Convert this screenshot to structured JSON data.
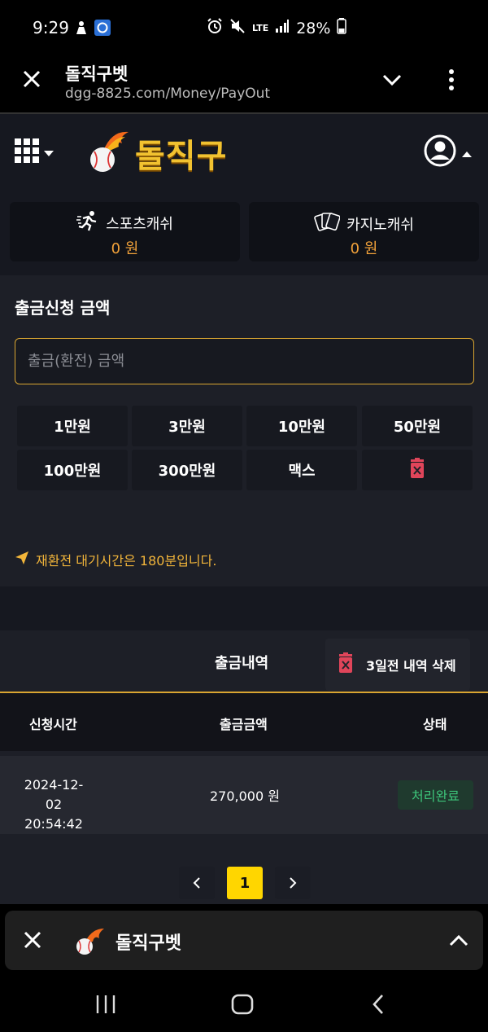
{
  "status_bar": {
    "time": "9:29",
    "battery": "28%",
    "network": "LTE"
  },
  "browser": {
    "title": "돌직구벳",
    "url": "dgg-8825.com/Money/PayOut"
  },
  "header": {
    "logo_text": "돌직구"
  },
  "cash": [
    {
      "label": "스포츠캐쉬",
      "amount": "0 원"
    },
    {
      "label": "카지노캐쉬",
      "amount": "0 원"
    }
  ],
  "withdraw": {
    "heading": "출금신청 금액",
    "placeholder": "출금(환전) 금액",
    "quick": [
      "1만원",
      "3만원",
      "10만원",
      "50만원",
      "100만원",
      "300만원",
      "맥스"
    ],
    "notice": "재환전 대기시간은 180분입니다."
  },
  "history": {
    "title": "출금내역",
    "delete_label": "3일전 내역 삭제",
    "columns": [
      "신청시간",
      "출금금액",
      "상태"
    ],
    "rows": [
      {
        "date": "2024-12-02",
        "time": "20:54:42",
        "amount": "270,000 원",
        "status": "처리완료"
      }
    ],
    "page": "1"
  },
  "tab": {
    "title": "돌직구벳"
  },
  "colors": {
    "accent": "#f2c230",
    "gold_border": "#d9a531",
    "success": "#3dc47a",
    "danger": "#e0455a"
  }
}
